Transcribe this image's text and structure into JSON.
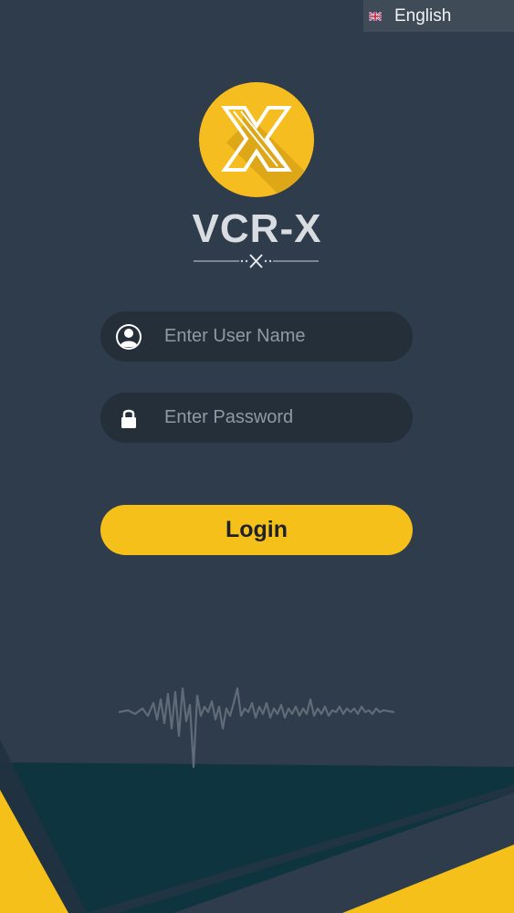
{
  "language_selector": {
    "label": "English",
    "flag_icon": "uk-flag-icon"
  },
  "brand": {
    "name": "VCR-X",
    "logo_icon": "x-logo-icon"
  },
  "login_form": {
    "username_placeholder": "Enter User Name",
    "username_value": "",
    "username_icon": "user-icon",
    "password_placeholder": "Enter Password",
    "password_value": "",
    "password_icon": "lock-icon",
    "login_label": "Login"
  },
  "colors": {
    "background": "#2e3c4b",
    "accent": "#f5c01a",
    "input_background": "#252f3a",
    "dark_stripe": "#0f3340"
  },
  "decoration": {
    "waveform_icon": "sound-wave-icon"
  }
}
